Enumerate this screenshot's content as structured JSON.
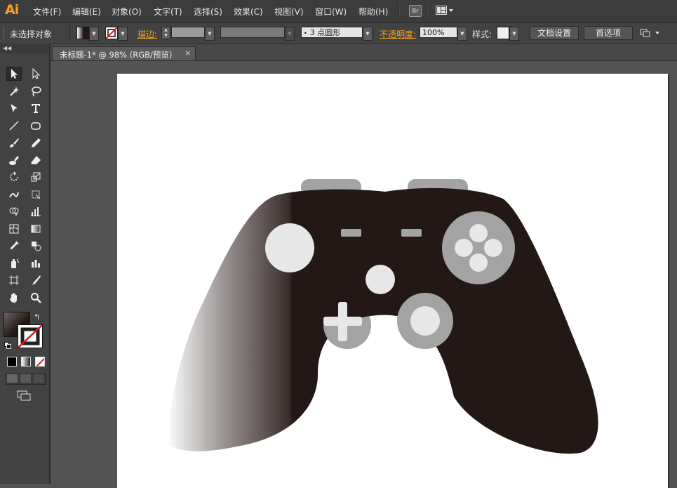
{
  "app": {
    "logo": "Ai"
  },
  "menu": [
    {
      "label": "文件(F)"
    },
    {
      "label": "编辑(E)"
    },
    {
      "label": "对象(O)"
    },
    {
      "label": "文字(T)"
    },
    {
      "label": "选择(S)"
    },
    {
      "label": "效果(C)"
    },
    {
      "label": "视图(V)"
    },
    {
      "label": "窗口(W)"
    },
    {
      "label": "帮助(H)"
    }
  ],
  "menubar_icons": {
    "bridge_label": "Br",
    "workspace_icon": "workspace-layout-icon"
  },
  "control_bar": {
    "selection_status": "未选择对象",
    "stroke_label": "描边:",
    "brush_value": "3 点圆形",
    "opacity_label": "不透明度:",
    "opacity_value": "100%",
    "style_label": "样式:",
    "doc_setup_button": "文档设置",
    "prefs_button": "首选项"
  },
  "document": {
    "tab_title": "未标题-1* @ 98% (RGB/预览)",
    "tab_close": "×"
  },
  "colors": {
    "accent": "#f7a21b",
    "controller_body": "#231816",
    "controller_grey": "#a3a3a3",
    "controller_light": "#e7e7e7"
  },
  "tools": [
    "selection-tool-icon",
    "direct-selection-tool-icon",
    "magic-wand-tool-icon",
    "lasso-tool-icon",
    "pen-tool-icon",
    "type-tool-icon",
    "line-segment-tool-icon",
    "rounded-rectangle-tool-icon",
    "paintbrush-tool-icon",
    "pencil-tool-icon",
    "blob-brush-tool-icon",
    "eraser-tool-icon",
    "rotate-tool-icon",
    "scale-tool-icon",
    "warp-tool-icon",
    "free-transform-tool-icon",
    "shape-builder-tool-icon",
    "graph-tool-icon",
    "mesh-tool-icon",
    "gradient-tool-icon",
    "eyedropper-tool-icon",
    "blend-tool-icon",
    "symbol-sprayer-tool-icon",
    "column-graph-tool-icon",
    "artboard-tool-icon",
    "slice-tool-icon",
    "hand-tool-icon",
    "zoom-tool-icon"
  ]
}
